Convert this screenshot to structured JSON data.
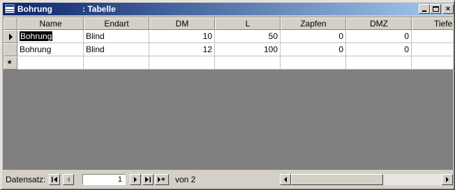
{
  "window": {
    "title_name": "Bohrung",
    "title_type": ": Tabelle",
    "minimize_symbol": "",
    "maximize_symbol": "",
    "close_symbol": "×"
  },
  "table": {
    "columns": [
      "Name",
      "Endart",
      "DM",
      "L",
      "Zapfen",
      "DMZ",
      "TiefeZ"
    ],
    "rows": [
      [
        "Bohrung",
        "Blind",
        "10",
        "50",
        "0",
        "0"
      ],
      [
        "Bohrung",
        "Blind",
        "12",
        "100",
        "0",
        "0"
      ]
    ],
    "new_row_marker": "*"
  },
  "navigator": {
    "label": "Datensatz:",
    "current_record": "1",
    "of_label": "von  2"
  },
  "colors": {
    "title_start": "#0a246a",
    "title_end": "#a6caf0",
    "face": "#d4d0c8",
    "grid_bg": "#808080"
  }
}
